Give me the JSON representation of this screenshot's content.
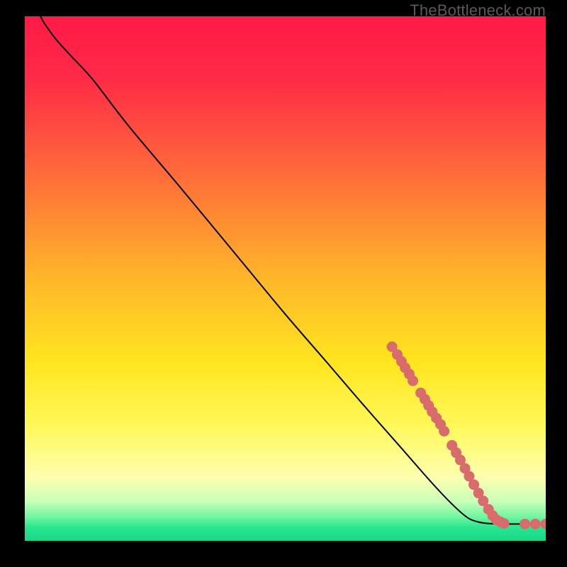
{
  "watermark": "TheBottleneck.com",
  "chart_data": {
    "type": "line",
    "title": "",
    "xlabel": "",
    "ylabel": "",
    "xlim": [
      0,
      100
    ],
    "ylim": [
      0,
      100
    ],
    "background_gradient_stops": [
      {
        "offset": 0.0,
        "color": "#ff1a47"
      },
      {
        "offset": 0.12,
        "color": "#ff2b47"
      },
      {
        "offset": 0.3,
        "color": "#ff6b3a"
      },
      {
        "offset": 0.5,
        "color": "#ffb62a"
      },
      {
        "offset": 0.66,
        "color": "#ffe51f"
      },
      {
        "offset": 0.78,
        "color": "#fff85a"
      },
      {
        "offset": 0.88,
        "color": "#fdffb0"
      },
      {
        "offset": 0.925,
        "color": "#c8ffb8"
      },
      {
        "offset": 0.955,
        "color": "#70f5a0"
      },
      {
        "offset": 0.975,
        "color": "#28e58f"
      },
      {
        "offset": 1.0,
        "color": "#17d98a"
      }
    ],
    "curve": [
      {
        "x": 3.0,
        "y": 100.0
      },
      {
        "x": 4.0,
        "y": 98.3
      },
      {
        "x": 6.0,
        "y": 95.6
      },
      {
        "x": 9.0,
        "y": 92.3
      },
      {
        "x": 13.0,
        "y": 88.0
      },
      {
        "x": 20.0,
        "y": 79.0
      },
      {
        "x": 30.0,
        "y": 67.2
      },
      {
        "x": 40.0,
        "y": 55.2
      },
      {
        "x": 50.0,
        "y": 43.2
      },
      {
        "x": 58.0,
        "y": 34.0
      },
      {
        "x": 65.0,
        "y": 25.9
      },
      {
        "x": 72.0,
        "y": 18.0
      },
      {
        "x": 78.0,
        "y": 11.2
      },
      {
        "x": 82.0,
        "y": 7.0
      },
      {
        "x": 85.0,
        "y": 4.4
      },
      {
        "x": 87.0,
        "y": 3.6
      },
      {
        "x": 89.0,
        "y": 3.3
      },
      {
        "x": 92.0,
        "y": 3.2
      },
      {
        "x": 96.0,
        "y": 3.2
      },
      {
        "x": 100.0,
        "y": 3.2
      }
    ],
    "series": [
      {
        "name": "points",
        "color": "#d86b6b",
        "points": [
          {
            "x": 70.5,
            "y": 37.0
          },
          {
            "x": 71.5,
            "y": 35.5
          },
          {
            "x": 72.3,
            "y": 34.2
          },
          {
            "x": 73.0,
            "y": 33.0
          },
          {
            "x": 73.8,
            "y": 31.8
          },
          {
            "x": 74.5,
            "y": 30.5
          },
          {
            "x": 76.0,
            "y": 28.2
          },
          {
            "x": 76.8,
            "y": 27.0
          },
          {
            "x": 77.5,
            "y": 25.8
          },
          {
            "x": 78.2,
            "y": 24.6
          },
          {
            "x": 79.0,
            "y": 23.4
          },
          {
            "x": 79.8,
            "y": 22.2
          },
          {
            "x": 80.5,
            "y": 20.9
          },
          {
            "x": 82.0,
            "y": 18.2
          },
          {
            "x": 82.8,
            "y": 16.8
          },
          {
            "x": 83.6,
            "y": 15.4
          },
          {
            "x": 84.5,
            "y": 13.8
          },
          {
            "x": 85.3,
            "y": 12.3
          },
          {
            "x": 86.2,
            "y": 10.7
          },
          {
            "x": 87.1,
            "y": 9.1
          },
          {
            "x": 88.0,
            "y": 7.6
          },
          {
            "x": 89.0,
            "y": 6.0
          },
          {
            "x": 89.8,
            "y": 4.8
          },
          {
            "x": 90.5,
            "y": 4.0
          },
          {
            "x": 91.3,
            "y": 3.6
          },
          {
            "x": 92.0,
            "y": 3.3
          },
          {
            "x": 96.0,
            "y": 3.2
          },
          {
            "x": 98.0,
            "y": 3.2
          },
          {
            "x": 100.0,
            "y": 3.2
          }
        ]
      }
    ]
  }
}
